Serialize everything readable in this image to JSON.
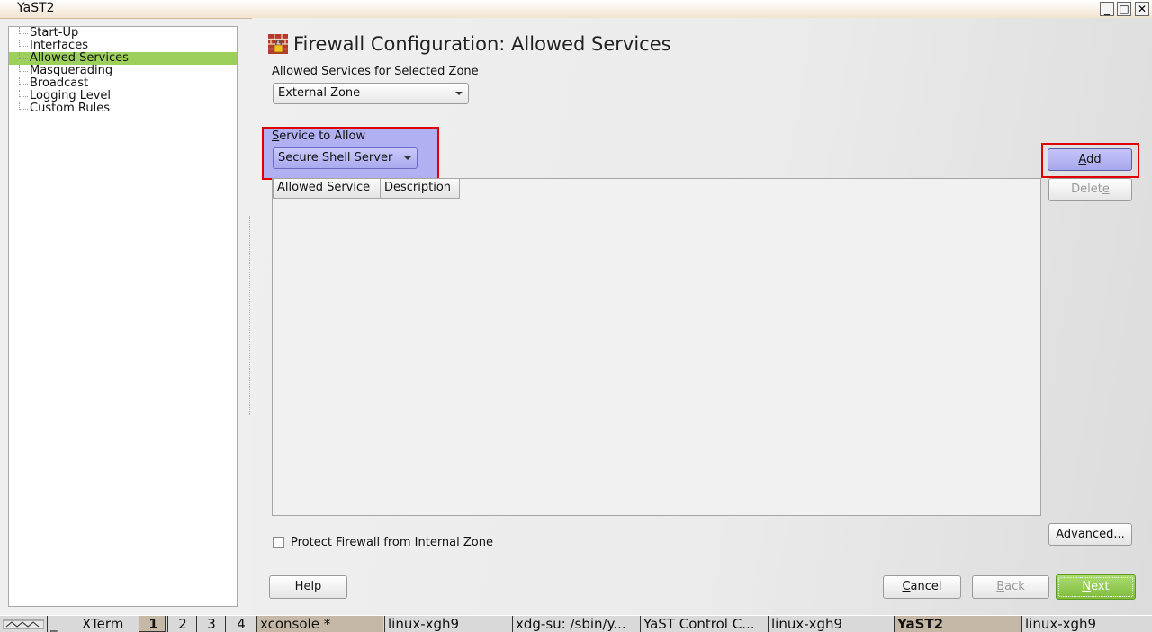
{
  "window": {
    "title": "YaST2",
    "controls": [
      "_",
      "□",
      "✕"
    ]
  },
  "tree": {
    "items": [
      {
        "label": "Start-Up",
        "selected": false
      },
      {
        "label": "Interfaces",
        "selected": false
      },
      {
        "label": "Allowed Services",
        "selected": true
      },
      {
        "label": "Masquerading",
        "selected": false
      },
      {
        "label": "Broadcast",
        "selected": false
      },
      {
        "label": "Logging Level",
        "selected": false
      },
      {
        "label": "Custom Rules",
        "selected": false
      }
    ]
  },
  "main": {
    "heading": "Firewall Configuration: Allowed Services",
    "heading_icon": "firewall-icon",
    "zone_label_pre": "A",
    "zone_label_mnemonic": "l",
    "zone_label_post": "lowed Services for Selected Zone",
    "zone_value": "External Zone",
    "service_label_mnemonic": "S",
    "service_label_post": "ervice to Allow",
    "service_value": "Secure Shell Server",
    "table_headers": [
      "Allowed Service",
      "Description"
    ],
    "table_rows": [],
    "protect_checkbox_label_mnemonic": "P",
    "protect_checkbox_label_post": "rotect Firewall from Internal Zone",
    "protect_checked": false
  },
  "buttons": {
    "add_mnemonic": "A",
    "add_post": "dd",
    "delete_pre": "Delet",
    "delete_mnemonic": "e",
    "advanced_pre": "Ad",
    "advanced_mnemonic": "v",
    "advanced_post": "anced...",
    "help": "Help",
    "cancel_mnemonic": "C",
    "cancel_post": "ancel",
    "back_mnemonic": "B",
    "back_post": "ack",
    "next_mnemonic": "N",
    "next_post": "ext"
  },
  "taskbar": {
    "items": [
      {
        "label": "_",
        "active": false
      },
      {
        "label": "XTerm",
        "active": false
      },
      {
        "label": "1",
        "active": true
      },
      {
        "label": "2",
        "active": false
      },
      {
        "label": "3",
        "active": false
      },
      {
        "label": "4",
        "active": false
      },
      {
        "label": "xconsole *",
        "active": true
      },
      {
        "label": "linux-xgh9",
        "active": false
      },
      {
        "label": "xdg-su: /sbin/y...",
        "active": false
      },
      {
        "label": "YaST Control C...",
        "active": false
      },
      {
        "label": "linux-xgh9",
        "active": false
      },
      {
        "label": "YaST2",
        "active": true
      },
      {
        "label": "linux-xgh9",
        "active": false
      }
    ]
  },
  "colors": {
    "selection_green": "#9ccf5b",
    "highlight_red": "#e00000",
    "focus_blue": "#b0b0f2",
    "next_green": "#8cc64d"
  }
}
